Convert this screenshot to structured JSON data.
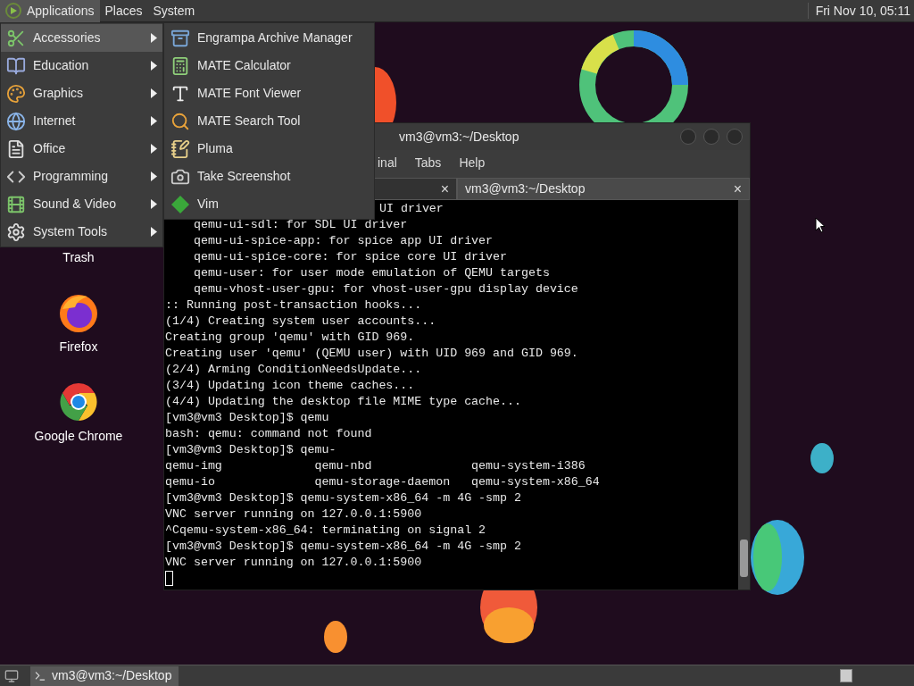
{
  "top_panel": {
    "menus": [
      {
        "label": "Applications",
        "selected": true
      },
      {
        "label": "Places",
        "selected": false
      },
      {
        "label": "System",
        "selected": false
      }
    ],
    "clock": "Fri Nov 10, 05:11"
  },
  "desktop_icons": [
    {
      "label": "Trash",
      "kind": "trash"
    },
    {
      "label": "Firefox",
      "kind": "firefox"
    },
    {
      "label": "Google Chrome",
      "kind": "chrome"
    }
  ],
  "terminal": {
    "title": "vm3@vm3:~/Desktop",
    "menu": [
      "inal",
      "Tabs",
      "Help"
    ],
    "tabs": [
      {
        "close": "×",
        "selected": false
      },
      {
        "label": "vm3@vm3:~/Desktop",
        "selected": true,
        "close": "×"
      }
    ],
    "lines": [
      "UI driver",
      "    qemu-ui-sdl: for SDL UI driver",
      "    qemu-ui-spice-app: for spice app UI driver",
      "    qemu-ui-spice-core: for spice core UI driver",
      "    qemu-user: for user mode emulation of QEMU targets",
      "    qemu-vhost-user-gpu: for vhost-user-gpu display device",
      ":: Running post-transaction hooks...",
      "(1/4) Creating system user accounts...",
      "Creating group 'qemu' with GID 969.",
      "Creating user 'qemu' (QEMU user) with UID 969 and GID 969.",
      "(2/4) Arming ConditionNeedsUpdate...",
      "(3/4) Updating icon theme caches...",
      "(4/4) Updating the desktop file MIME type cache...",
      "[vm3@vm3 Desktop]$ qemu",
      "bash: qemu: command not found",
      "[vm3@vm3 Desktop]$ qemu-",
      "qemu-img             qemu-nbd              qemu-system-i386",
      "qemu-io              qemu-storage-daemon   qemu-system-x86_64",
      "[vm3@vm3 Desktop]$ qemu-system-x86_64 -m 4G -smp 2",
      "VNC server running on 127.0.0.1:5900",
      "^Cqemu-system-x86_64: terminating on signal 2",
      "[vm3@vm3 Desktop]$ qemu-system-x86_64 -m 4G -smp 2",
      "VNC server running on 127.0.0.1:5900"
    ]
  },
  "applications_menu": {
    "items": [
      {
        "label": "Accessories",
        "selected": true
      },
      {
        "label": "Education",
        "selected": false
      },
      {
        "label": "Graphics",
        "selected": false
      },
      {
        "label": "Internet",
        "selected": false
      },
      {
        "label": "Office",
        "selected": false
      },
      {
        "label": "Programming",
        "selected": false
      },
      {
        "label": "Sound & Video",
        "selected": false
      },
      {
        "label": "System Tools",
        "selected": false
      }
    ],
    "submenu": [
      "Engrampa Archive Manager",
      "MATE Calculator",
      "MATE Font Viewer",
      "MATE Search Tool",
      "Pluma",
      "Take Screenshot",
      "Vim"
    ]
  },
  "taskbar": {
    "tasks": [
      {
        "label": "vm3@vm3:~/Desktop",
        "selected": true
      }
    ]
  }
}
